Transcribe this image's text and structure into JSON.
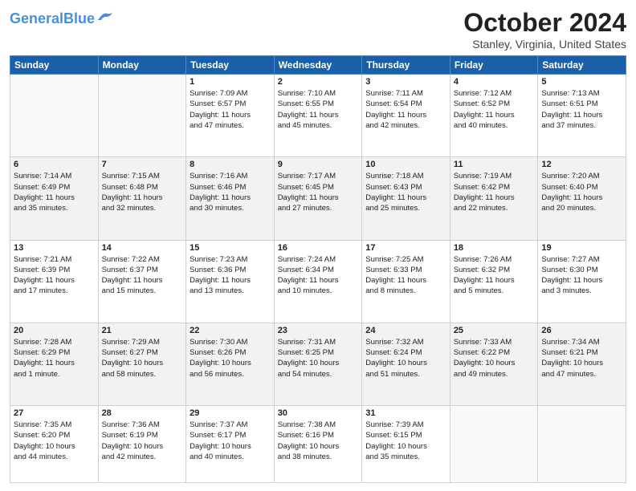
{
  "header": {
    "logo_line1": "General",
    "logo_line2": "Blue",
    "month_title": "October 2024",
    "location": "Stanley, Virginia, United States"
  },
  "weekdays": [
    "Sunday",
    "Monday",
    "Tuesday",
    "Wednesday",
    "Thursday",
    "Friday",
    "Saturday"
  ],
  "weeks": [
    [
      {
        "day": "",
        "info": ""
      },
      {
        "day": "",
        "info": ""
      },
      {
        "day": "1",
        "info": "Sunrise: 7:09 AM\nSunset: 6:57 PM\nDaylight: 11 hours\nand 47 minutes."
      },
      {
        "day": "2",
        "info": "Sunrise: 7:10 AM\nSunset: 6:55 PM\nDaylight: 11 hours\nand 45 minutes."
      },
      {
        "day": "3",
        "info": "Sunrise: 7:11 AM\nSunset: 6:54 PM\nDaylight: 11 hours\nand 42 minutes."
      },
      {
        "day": "4",
        "info": "Sunrise: 7:12 AM\nSunset: 6:52 PM\nDaylight: 11 hours\nand 40 minutes."
      },
      {
        "day": "5",
        "info": "Sunrise: 7:13 AM\nSunset: 6:51 PM\nDaylight: 11 hours\nand 37 minutes."
      }
    ],
    [
      {
        "day": "6",
        "info": "Sunrise: 7:14 AM\nSunset: 6:49 PM\nDaylight: 11 hours\nand 35 minutes."
      },
      {
        "day": "7",
        "info": "Sunrise: 7:15 AM\nSunset: 6:48 PM\nDaylight: 11 hours\nand 32 minutes."
      },
      {
        "day": "8",
        "info": "Sunrise: 7:16 AM\nSunset: 6:46 PM\nDaylight: 11 hours\nand 30 minutes."
      },
      {
        "day": "9",
        "info": "Sunrise: 7:17 AM\nSunset: 6:45 PM\nDaylight: 11 hours\nand 27 minutes."
      },
      {
        "day": "10",
        "info": "Sunrise: 7:18 AM\nSunset: 6:43 PM\nDaylight: 11 hours\nand 25 minutes."
      },
      {
        "day": "11",
        "info": "Sunrise: 7:19 AM\nSunset: 6:42 PM\nDaylight: 11 hours\nand 22 minutes."
      },
      {
        "day": "12",
        "info": "Sunrise: 7:20 AM\nSunset: 6:40 PM\nDaylight: 11 hours\nand 20 minutes."
      }
    ],
    [
      {
        "day": "13",
        "info": "Sunrise: 7:21 AM\nSunset: 6:39 PM\nDaylight: 11 hours\nand 17 minutes."
      },
      {
        "day": "14",
        "info": "Sunrise: 7:22 AM\nSunset: 6:37 PM\nDaylight: 11 hours\nand 15 minutes."
      },
      {
        "day": "15",
        "info": "Sunrise: 7:23 AM\nSunset: 6:36 PM\nDaylight: 11 hours\nand 13 minutes."
      },
      {
        "day": "16",
        "info": "Sunrise: 7:24 AM\nSunset: 6:34 PM\nDaylight: 11 hours\nand 10 minutes."
      },
      {
        "day": "17",
        "info": "Sunrise: 7:25 AM\nSunset: 6:33 PM\nDaylight: 11 hours\nand 8 minutes."
      },
      {
        "day": "18",
        "info": "Sunrise: 7:26 AM\nSunset: 6:32 PM\nDaylight: 11 hours\nand 5 minutes."
      },
      {
        "day": "19",
        "info": "Sunrise: 7:27 AM\nSunset: 6:30 PM\nDaylight: 11 hours\nand 3 minutes."
      }
    ],
    [
      {
        "day": "20",
        "info": "Sunrise: 7:28 AM\nSunset: 6:29 PM\nDaylight: 11 hours\nand 1 minute."
      },
      {
        "day": "21",
        "info": "Sunrise: 7:29 AM\nSunset: 6:27 PM\nDaylight: 10 hours\nand 58 minutes."
      },
      {
        "day": "22",
        "info": "Sunrise: 7:30 AM\nSunset: 6:26 PM\nDaylight: 10 hours\nand 56 minutes."
      },
      {
        "day": "23",
        "info": "Sunrise: 7:31 AM\nSunset: 6:25 PM\nDaylight: 10 hours\nand 54 minutes."
      },
      {
        "day": "24",
        "info": "Sunrise: 7:32 AM\nSunset: 6:24 PM\nDaylight: 10 hours\nand 51 minutes."
      },
      {
        "day": "25",
        "info": "Sunrise: 7:33 AM\nSunset: 6:22 PM\nDaylight: 10 hours\nand 49 minutes."
      },
      {
        "day": "26",
        "info": "Sunrise: 7:34 AM\nSunset: 6:21 PM\nDaylight: 10 hours\nand 47 minutes."
      }
    ],
    [
      {
        "day": "27",
        "info": "Sunrise: 7:35 AM\nSunset: 6:20 PM\nDaylight: 10 hours\nand 44 minutes."
      },
      {
        "day": "28",
        "info": "Sunrise: 7:36 AM\nSunset: 6:19 PM\nDaylight: 10 hours\nand 42 minutes."
      },
      {
        "day": "29",
        "info": "Sunrise: 7:37 AM\nSunset: 6:17 PM\nDaylight: 10 hours\nand 40 minutes."
      },
      {
        "day": "30",
        "info": "Sunrise: 7:38 AM\nSunset: 6:16 PM\nDaylight: 10 hours\nand 38 minutes."
      },
      {
        "day": "31",
        "info": "Sunrise: 7:39 AM\nSunset: 6:15 PM\nDaylight: 10 hours\nand 35 minutes."
      },
      {
        "day": "",
        "info": ""
      },
      {
        "day": "",
        "info": ""
      }
    ]
  ]
}
